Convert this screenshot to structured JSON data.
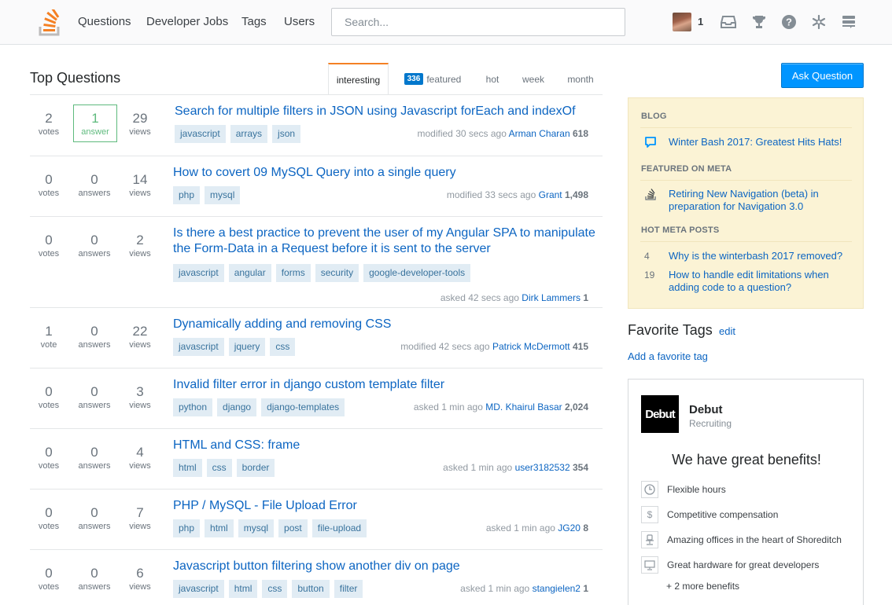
{
  "topbar": {
    "nav": [
      "Questions",
      "Developer Jobs",
      "Tags",
      "Users"
    ],
    "search_placeholder": "Search...",
    "reputation": "1",
    "icons": [
      "inbox-icon",
      "achievements-icon",
      "help-icon",
      "review-icon",
      "site-switcher-icon"
    ]
  },
  "header": {
    "title": "Top Questions",
    "tabs": [
      {
        "label": "interesting",
        "active": true
      },
      {
        "label": "featured",
        "badge": "336"
      },
      {
        "label": "hot"
      },
      {
        "label": "week"
      },
      {
        "label": "month"
      }
    ],
    "ask_button": "Ask Question"
  },
  "questions": [
    {
      "votes": "2",
      "votes_lbl": "votes",
      "answers": "1",
      "answers_lbl": "answer",
      "views": "29",
      "views_lbl": "views",
      "title": "Search for multiple filters in JSON using Javascript forEach and indexOf",
      "tags": [
        "javascript",
        "arrays",
        "json"
      ],
      "action": "modified 30 secs ago",
      "user": "Arman Charan",
      "rep": "618",
      "answered": true
    },
    {
      "votes": "0",
      "votes_lbl": "votes",
      "answers": "0",
      "answers_lbl": "answers",
      "views": "14",
      "views_lbl": "views",
      "title": "How to covert 09 MySQL Query into a single query",
      "tags": [
        "php",
        "mysql"
      ],
      "action": "modified 33 secs ago",
      "user": "Grant",
      "rep": "1,498"
    },
    {
      "votes": "0",
      "votes_lbl": "votes",
      "answers": "0",
      "answers_lbl": "answers",
      "views": "2",
      "views_lbl": "views",
      "title": "Is there a best practice to prevent the user of my Angular SPA to manipulate the Form-Data in a Request before it is sent to the server",
      "tags": [
        "javascript",
        "angular",
        "forms",
        "security",
        "google-developer-tools"
      ],
      "action": "asked 42 secs ago",
      "user": "Dirk Lammers",
      "rep": "1"
    },
    {
      "votes": "1",
      "votes_lbl": "vote",
      "answers": "0",
      "answers_lbl": "answers",
      "views": "22",
      "views_lbl": "views",
      "title": "Dynamically adding and removing CSS",
      "tags": [
        "javascript",
        "jquery",
        "css"
      ],
      "action": "modified 42 secs ago",
      "user": "Patrick McDermott",
      "rep": "415"
    },
    {
      "votes": "0",
      "votes_lbl": "votes",
      "answers": "0",
      "answers_lbl": "answers",
      "views": "3",
      "views_lbl": "views",
      "title": "Invalid filter error in django custom template filter",
      "tags": [
        "python",
        "django",
        "django-templates"
      ],
      "action": "asked 1 min ago",
      "user": "MD. Khairul Basar",
      "rep": "2,024"
    },
    {
      "votes": "0",
      "votes_lbl": "votes",
      "answers": "0",
      "answers_lbl": "answers",
      "views": "4",
      "views_lbl": "views",
      "title": "HTML and CSS: frame",
      "tags": [
        "html",
        "css",
        "border"
      ],
      "action": "asked 1 min ago",
      "user": "user3182532",
      "rep": "354"
    },
    {
      "votes": "0",
      "votes_lbl": "votes",
      "answers": "0",
      "answers_lbl": "answers",
      "views": "7",
      "views_lbl": "views",
      "title": "PHP / MySQL - File Upload Error",
      "tags": [
        "php",
        "html",
        "mysql",
        "post",
        "file-upload"
      ],
      "action": "asked 1 min ago",
      "user": "JG20",
      "rep": "8"
    },
    {
      "votes": "0",
      "votes_lbl": "votes",
      "answers": "0",
      "answers_lbl": "answers",
      "views": "6",
      "views_lbl": "views",
      "title": "Javascript button filtering show another div on page",
      "tags": [
        "javascript",
        "html",
        "css",
        "button",
        "filter"
      ],
      "action": "asked 1 min ago",
      "user": "stangielen2",
      "rep": "1"
    }
  ],
  "sidebar": {
    "blog_heading": "BLOG",
    "blog_link": "Winter Bash 2017: Greatest Hits Hats!",
    "meta_heading": "FEATURED ON META",
    "meta_link": "Retiring New Navigation (beta) in preparation for Navigation 3.0",
    "hot_heading": "HOT META POSTS",
    "hot_posts": [
      {
        "count": "4",
        "title": "Why is the winterbash 2017 removed?"
      },
      {
        "count": "19",
        "title": "How to handle edit limitations when adding code to a question?"
      }
    ],
    "favorite_title": "Favorite Tags",
    "favorite_edit": "edit",
    "favorite_add": "Add a favorite tag"
  },
  "job": {
    "logo_text": "Debut",
    "company": "Debut",
    "subtitle": "Recruiting",
    "headline": "We have great benefits!",
    "benefits": [
      {
        "icon": "clock-icon",
        "text": "Flexible hours"
      },
      {
        "icon": "dollar-icon",
        "text": "Competitive compensation"
      },
      {
        "icon": "office-chair-icon",
        "text": "Amazing offices in the heart of Shoreditch"
      },
      {
        "icon": "monitor-icon",
        "text": "Great hardware for great developers"
      }
    ],
    "more": "+ 2 more benefits"
  },
  "colors": {
    "brand_orange": "#f48024",
    "link_blue": "#0c65c2",
    "accept_green": "#5eba7d",
    "button_blue": "#0095ff"
  }
}
